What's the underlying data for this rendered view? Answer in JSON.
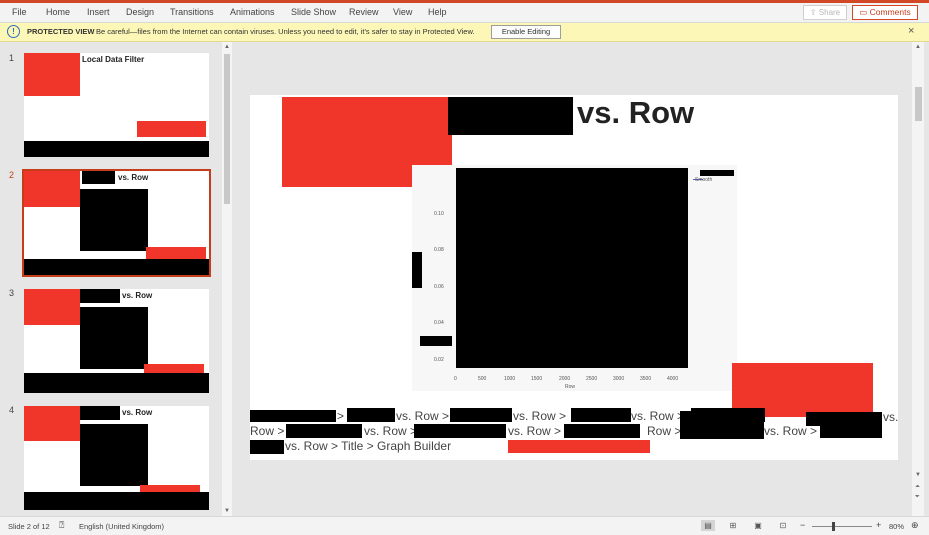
{
  "ribbon": {
    "menu": [
      "File",
      "Home",
      "Insert",
      "Design",
      "Transitions",
      "Animations",
      "Slide Show",
      "Review",
      "View",
      "Help"
    ],
    "share_label": "Share",
    "comments_label": "Comments"
  },
  "protected_view": {
    "title": "PROTECTED VIEW",
    "message": "Be careful—files from the Internet can contain viruses. Unless you need to edit, it's safer to stay in Protected View.",
    "enable_label": "Enable Editing",
    "close_glyph": "×"
  },
  "thumbnails": [
    {
      "number": "1",
      "title": "Local Data Filter"
    },
    {
      "number": "2",
      "title": "vs. Row"
    },
    {
      "number": "3",
      "title": "vs. Row"
    },
    {
      "number": "4",
      "title": "vs. Row"
    }
  ],
  "slide": {
    "title": "vs. Row",
    "legend_smooth": "Smooth",
    "y_ticks": [
      "0.10",
      "0.08",
      "0.06",
      "0.04",
      "0.02"
    ],
    "x_ticks": [
      "0",
      "500",
      "1000",
      "1500",
      "2000",
      "2500",
      "3000",
      "3500",
      "4000"
    ],
    "x_axis_label": "Row",
    "breadcrumb": {
      "seg1": ">",
      "seg2": "vs. Row >",
      "seg3": "vs. Row >",
      "seg4": "vs. Row >",
      "seg5": "vs.",
      "line2_start": "Row >",
      "seg6": "vs. Row >",
      "seg7": "vs. Row >",
      "seg8": "Row >",
      "seg9": "vs. Row >",
      "line3": "vs. Row > Title > Graph Builder"
    }
  },
  "status": {
    "slide_info": "Slide 2 of 12",
    "language": "English (United Kingdom)",
    "zoom": "80%"
  },
  "colors": {
    "accent": "#c43e1c",
    "redaction": "#000000",
    "red_block": "#f0352a",
    "protected_bar": "#fcf7b6"
  }
}
